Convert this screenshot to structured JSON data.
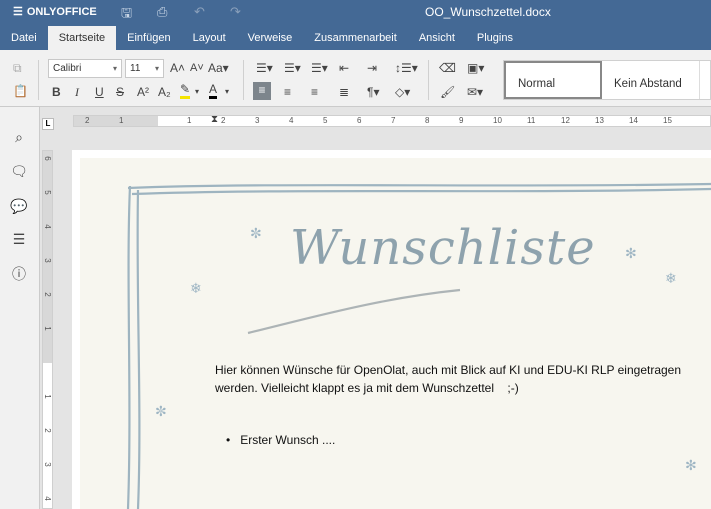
{
  "app": {
    "brand": "ONLYOFFICE",
    "doc_title": "OO_Wunschzettel.docx"
  },
  "quick_access": [
    "save-icon",
    "print-icon",
    "undo-icon",
    "redo-icon"
  ],
  "tabs": [
    {
      "label": "Datei"
    },
    {
      "label": "Startseite",
      "active": true
    },
    {
      "label": "Einfügen"
    },
    {
      "label": "Layout"
    },
    {
      "label": "Verweise"
    },
    {
      "label": "Zusammenarbeit"
    },
    {
      "label": "Ansicht"
    },
    {
      "label": "Plugins"
    }
  ],
  "toolbar": {
    "font_name": "Calibri",
    "font_size": "11",
    "highlight_color": "#f5e400",
    "font_color": "#000000"
  },
  "styles": [
    {
      "label": "Normal",
      "active": true
    },
    {
      "label": "Kein Abstand"
    }
  ],
  "ruler": {
    "h_labels": [
      "2",
      "1",
      "1",
      "2",
      "3",
      "4",
      "5",
      "6",
      "7",
      "8",
      "9",
      "10",
      "11",
      "12",
      "13",
      "14",
      "15"
    ],
    "v_labels": [
      "6",
      "5",
      "4",
      "3",
      "2",
      "1",
      "1",
      "2",
      "3",
      "4"
    ]
  },
  "document": {
    "heading": "Wunschliste",
    "paragraph": [
      "Hier können Wünsche für OpenOlat, auch mit Blick auf KI und EDU-KI RLP eingetragen",
      "werden. Vielleicht klappt es ja mit dem Wunschzettel    ;-)"
    ],
    "bullets": [
      "Erster Wunsch ...."
    ]
  },
  "colors": {
    "header": "#446995",
    "border_art": "#8fa9b8"
  }
}
